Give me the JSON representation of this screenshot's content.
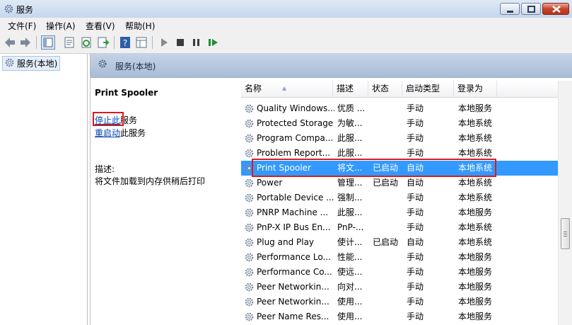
{
  "window": {
    "title": "服务"
  },
  "menu": [
    "文件(F)",
    "操作(A)",
    "查看(V)",
    "帮助(H)"
  ],
  "tree": {
    "root_label": "服务(本地)"
  },
  "pane": {
    "header": "服务(本地)"
  },
  "detail": {
    "service_name": "Print Spooler",
    "stop_link": "停止此",
    "stop_suffix": "服务",
    "restart_link": "重启动",
    "restart_suffix": "此服务",
    "desc_label": "描述:",
    "desc_text": "将文件加载到内存供稍后打印"
  },
  "columns": [
    "名称",
    "描述",
    "状态",
    "启动类型",
    "登录为"
  ],
  "services": [
    {
      "name": "Quality Windows...",
      "desc": "优质 ...",
      "status": "",
      "startup": "手动",
      "logon": "本地服务"
    },
    {
      "name": "Protected Storage",
      "desc": "为敏...",
      "status": "",
      "startup": "手动",
      "logon": "本地系统"
    },
    {
      "name": "Program Compa...",
      "desc": "此服...",
      "status": "",
      "startup": "手动",
      "logon": "本地系统"
    },
    {
      "name": "Problem Report...",
      "desc": "此服...",
      "status": "",
      "startup": "手动",
      "logon": "本地系统"
    },
    {
      "name": "Print Spooler",
      "desc": "将文...",
      "status": "已启动",
      "startup": "自动",
      "logon": "本地系统"
    },
    {
      "name": "Power",
      "desc": "管理...",
      "status": "已启动",
      "startup": "自动",
      "logon": "本地系统"
    },
    {
      "name": "Portable Device ...",
      "desc": "强制...",
      "status": "",
      "startup": "手动",
      "logon": "本地系统"
    },
    {
      "name": "PNRP Machine ...",
      "desc": "此服...",
      "status": "",
      "startup": "手动",
      "logon": "本地服务"
    },
    {
      "name": "PnP-X IP Bus En...",
      "desc": "PnP-...",
      "status": "",
      "startup": "手动",
      "logon": "本地系统"
    },
    {
      "name": "Plug and Play",
      "desc": "使计...",
      "status": "已启动",
      "startup": "自动",
      "logon": "本地系统"
    },
    {
      "name": "Performance Lo...",
      "desc": "性能...",
      "status": "",
      "startup": "手动",
      "logon": "本地服务"
    },
    {
      "name": "Performance Co...",
      "desc": "使远...",
      "status": "",
      "startup": "手动",
      "logon": "本地服务"
    },
    {
      "name": "Peer Networkin...",
      "desc": "向对...",
      "status": "",
      "startup": "手动",
      "logon": "本地服务"
    },
    {
      "name": "Peer Networkin...",
      "desc": "使用...",
      "status": "",
      "startup": "手动",
      "logon": "本地服务"
    },
    {
      "name": "Peer Name Res...",
      "desc": "使用...",
      "status": "",
      "startup": "手动",
      "logon": "本地服务"
    }
  ],
  "selected_service": "Print Spooler",
  "colors": {
    "selection": "#3399ff",
    "highlight_box": "#e0191b",
    "link": "#0645ad"
  }
}
